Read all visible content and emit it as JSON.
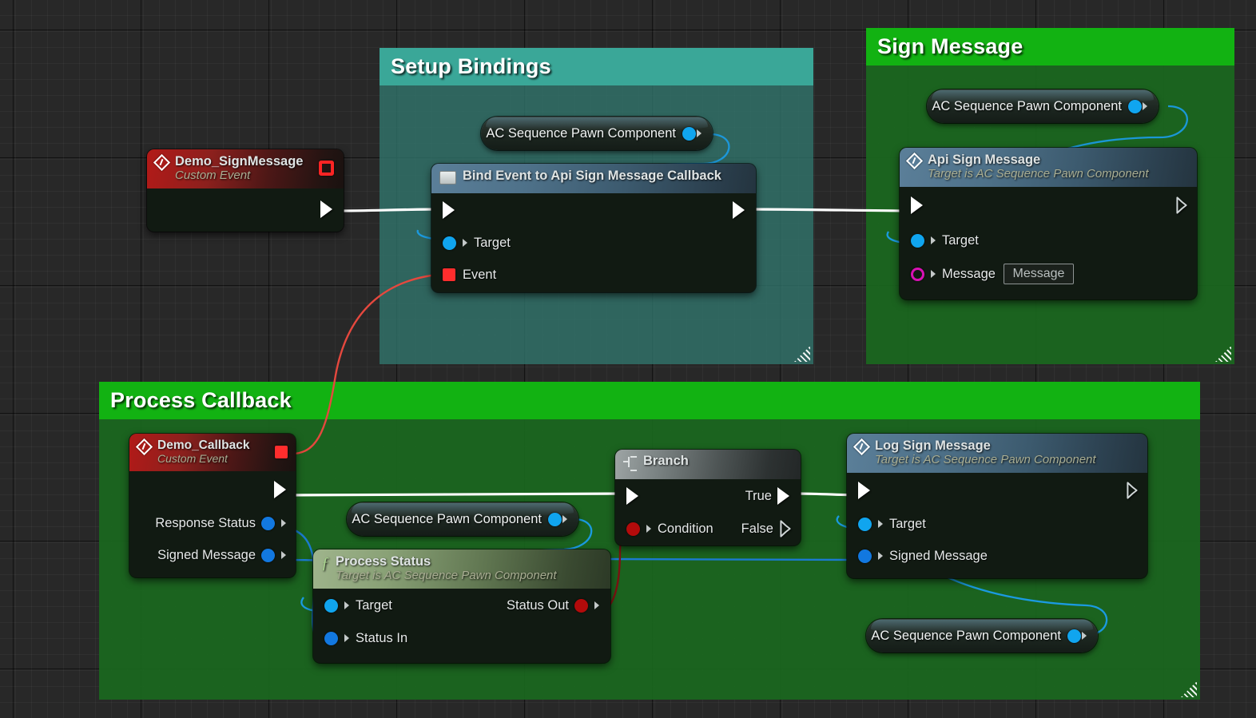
{
  "graph": {
    "background_color": "#282828",
    "grid_minor_color": "#333333",
    "grid_major_color": "#151515"
  },
  "comments": [
    {
      "name": "setup-bindings",
      "title": "Setup Bindings",
      "header_color": "#3aa798",
      "body_color": "#31746b"
    },
    {
      "name": "sign-message",
      "title": "Sign Message",
      "header_color": "#12b212",
      "body_color": "#1a681e"
    },
    {
      "name": "process-callback",
      "title": "Process Callback",
      "header_color": "#12b212",
      "body_color": "#1a681e"
    }
  ],
  "nodes": {
    "demo_sign_message": {
      "title": "Demo_SignMessage",
      "subtitle": "Custom Event",
      "icon": "event-diamond-icon",
      "header_color": "#b21a18",
      "delegate_pin": "delegate-output-pin",
      "exec_out": "exec-output-pin"
    },
    "bind_event": {
      "title": "Bind Event to Api Sign Message Callback",
      "icon": "bind-event-icon",
      "header_color": "#5b7f99",
      "inputs": [
        {
          "label": "Target",
          "pin": "object-pin",
          "color": "#10a5ef"
        },
        {
          "label": "Event",
          "pin": "delegate-pin",
          "color": "#ff2d2d"
        }
      ]
    },
    "api_sign_message": {
      "title": "Api Sign Message",
      "subtitle": "Target is AC Sequence Pawn Component",
      "icon": "function-diamond-icon",
      "header_color": "#5b7f99",
      "inputs": [
        {
          "label": "Target",
          "pin": "object-pin",
          "color": "#10a5ef"
        },
        {
          "label": "Message",
          "pin": "string-pin",
          "color": "#d911b4",
          "value": "Message"
        }
      ]
    },
    "demo_callback": {
      "title": "Demo_Callback",
      "subtitle": "Custom Event",
      "icon": "event-diamond-icon",
      "header_color": "#b21a18",
      "outputs": [
        {
          "label": "Response Status",
          "pin": "struct-pin",
          "color": "#1278e0"
        },
        {
          "label": "Signed Message",
          "pin": "struct-pin",
          "color": "#1278e0"
        }
      ]
    },
    "process_status": {
      "title": "Process Status",
      "subtitle": "Target is AC Sequence Pawn Component",
      "icon": "pure-function-icon",
      "header_color": "#89a176",
      "inputs": [
        {
          "label": "Target",
          "pin": "object-pin",
          "color": "#10a5ef"
        },
        {
          "label": "Status In",
          "pin": "struct-pin",
          "color": "#1278e0"
        }
      ],
      "outputs": [
        {
          "label": "Status Out",
          "pin": "bool-pin",
          "color": "#b30b0b"
        }
      ]
    },
    "branch": {
      "title": "Branch",
      "icon": "branch-icon",
      "header_color": "#7d8585",
      "inputs": [
        {
          "label": "Condition",
          "pin": "bool-pin",
          "color": "#b30b0b"
        }
      ],
      "outputs": [
        {
          "label": "True",
          "pin": "exec-pin"
        },
        {
          "label": "False",
          "pin": "exec-pin"
        }
      ]
    },
    "log_sign_message": {
      "title": "Log Sign Message",
      "subtitle": "Target is AC Sequence Pawn Component",
      "icon": "function-diamond-icon",
      "header_color": "#5b7f99",
      "inputs": [
        {
          "label": "Target",
          "pin": "object-pin",
          "color": "#10a5ef"
        },
        {
          "label": "Signed Message",
          "pin": "struct-pin",
          "color": "#1278e0"
        }
      ]
    }
  },
  "getters": [
    {
      "name": "getter-setup-bindings",
      "label": "AC Sequence Pawn Component",
      "pin_color": "#10a5ef"
    },
    {
      "name": "getter-sign-message",
      "label": "AC Sequence Pawn Component",
      "pin_color": "#10a5ef"
    },
    {
      "name": "getter-process-status",
      "label": "AC Sequence Pawn Component",
      "pin_color": "#10a5ef"
    },
    {
      "name": "getter-log-sign-message",
      "label": "AC Sequence Pawn Component",
      "pin_color": "#10a5ef"
    }
  ],
  "wire_colors": {
    "exec": "#ffffff",
    "object": "#1b9ae0",
    "delegate": "#e5483e",
    "bool": "#7d1212"
  }
}
